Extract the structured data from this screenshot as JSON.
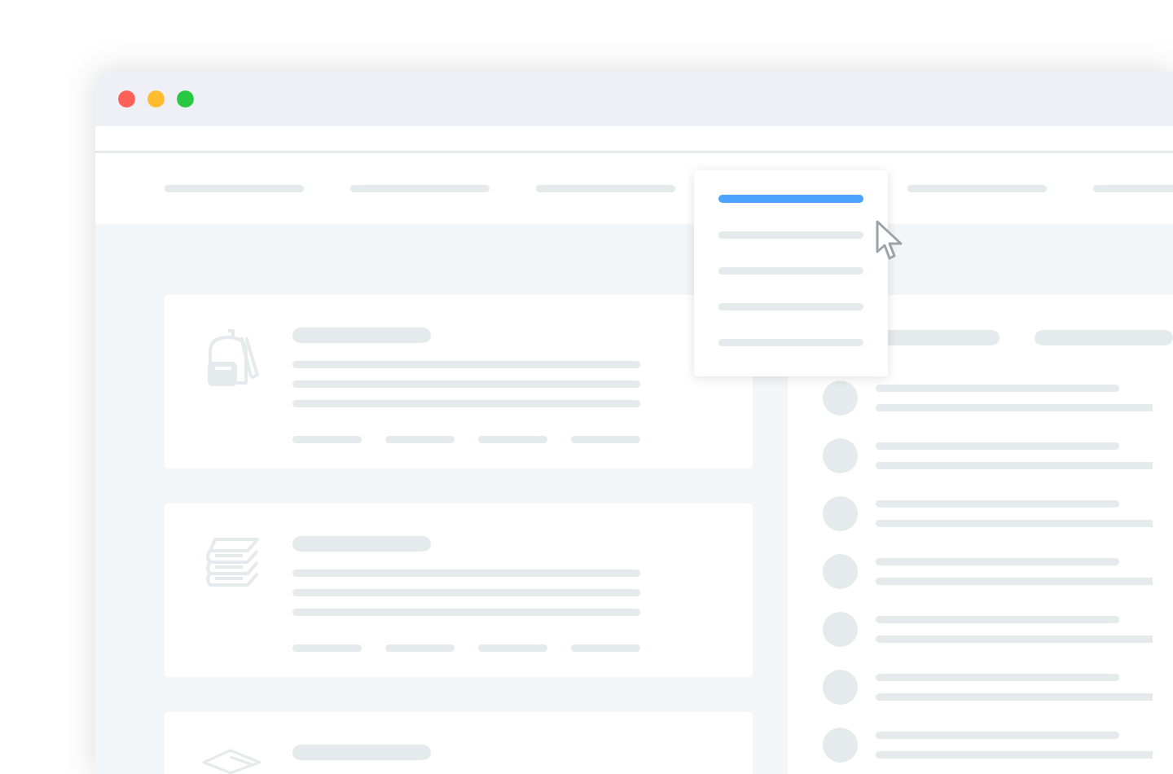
{
  "window_controls": [
    {
      "color": "#fe5f57"
    },
    {
      "color": "#febc2e"
    },
    {
      "color": "#28c840"
    }
  ],
  "nav": [
    {
      "kind": "bar"
    },
    {
      "kind": "bar"
    },
    {
      "kind": "bar"
    },
    {
      "kind": "menu"
    },
    {
      "kind": "bar"
    },
    {
      "kind": "bar"
    }
  ],
  "dropdown": [
    {
      "selected": true
    },
    {
      "selected": false
    },
    {
      "selected": false
    },
    {
      "selected": false
    },
    {
      "selected": false
    }
  ],
  "cards": [
    {
      "kind": "backpack"
    },
    {
      "kind": "books"
    },
    {
      "kind": "cap"
    }
  ],
  "side_tabs": [
    {
      "selected": false
    },
    {
      "selected": false
    }
  ],
  "side_rows": [
    {
      "kind": "row"
    },
    {
      "kind": "row"
    },
    {
      "kind": "row"
    },
    {
      "kind": "row"
    },
    {
      "kind": "row"
    },
    {
      "kind": "row"
    },
    {
      "kind": "row"
    }
  ]
}
